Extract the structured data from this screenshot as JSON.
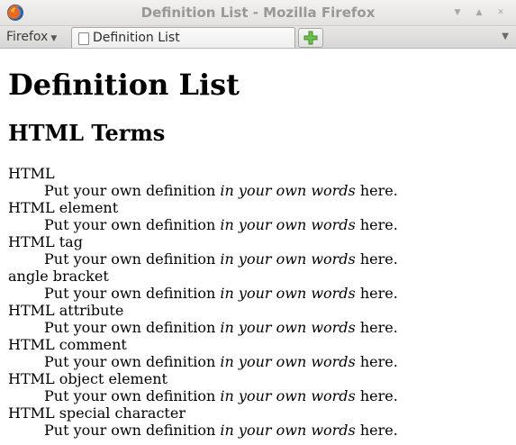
{
  "window": {
    "title": "Definition List - Mozilla Firefox",
    "minimize_glyph": "▼",
    "maximize_glyph": "▲",
    "close_glyph": "✕"
  },
  "tabbar": {
    "firefox_menu_label": "Firefox",
    "firefox_menu_arrow": "▼",
    "tabs": [
      {
        "label": "Definition List"
      }
    ],
    "tablist_glyph": "▼"
  },
  "page": {
    "heading": "Definition List",
    "subheading": "HTML Terms",
    "definition_parts": {
      "before": "Put your own definition ",
      "emphasis": "in your own words",
      "after": " here."
    },
    "terms": [
      "HTML",
      "HTML element",
      "HTML tag",
      "angle bracket",
      "HTML attribute",
      "HTML comment",
      "HTML object element",
      "HTML special character"
    ]
  },
  "colors": {
    "title_text": "#9a9896",
    "new_tab_plus": "#6cc24a"
  }
}
